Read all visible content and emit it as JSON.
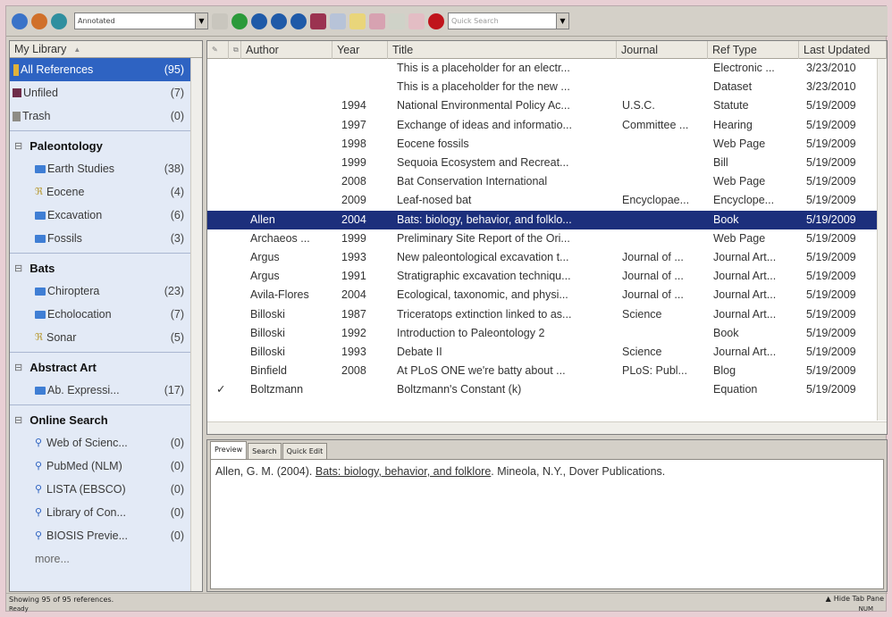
{
  "toolbar": {
    "style_value": "Annotated",
    "quick_search_placeholder": "Quick Search"
  },
  "library": {
    "header": "My Library",
    "all_refs": {
      "label": "All References",
      "count": "(95)"
    },
    "unfiled": {
      "label": "Unfiled",
      "count": "(7)"
    },
    "trash": {
      "label": "Trash",
      "count": "(0)"
    },
    "groups": [
      {
        "title": "Paleontology",
        "items": [
          {
            "label": "Earth Studies",
            "count": "(38)"
          },
          {
            "label": "Eocene",
            "count": "(4)"
          },
          {
            "label": "Excavation",
            "count": "(6)"
          },
          {
            "label": "Fossils",
            "count": "(3)"
          }
        ]
      },
      {
        "title": "Bats",
        "items": [
          {
            "label": "Chiroptera",
            "count": "(23)"
          },
          {
            "label": "Echolocation",
            "count": "(7)"
          },
          {
            "label": "Sonar",
            "count": "(5)"
          }
        ]
      },
      {
        "title": "Abstract Art",
        "items": [
          {
            "label": "Ab. Expressi...",
            "count": "(17)"
          }
        ]
      },
      {
        "title": "Online Search",
        "items": [
          {
            "label": "Web of Scienc...",
            "count": "(0)"
          },
          {
            "label": "PubMed (NLM)",
            "count": "(0)"
          },
          {
            "label": "LISTA (EBSCO)",
            "count": "(0)"
          },
          {
            "label": "Library of Con...",
            "count": "(0)"
          },
          {
            "label": "BIOSIS Previe...",
            "count": "(0)"
          }
        ]
      }
    ],
    "more": "more..."
  },
  "columns": {
    "author": "Author",
    "year": "Year",
    "title": "Title",
    "journal": "Journal",
    "reftype": "Ref Type",
    "updated": "Last Updated"
  },
  "references": [
    {
      "read": "",
      "author": "",
      "year": "",
      "title": "This is a placeholder for an electr...",
      "journal": "",
      "reftype": "Electronic ...",
      "updated": "3/23/2010"
    },
    {
      "read": "",
      "author": "",
      "year": "",
      "title": "This is a placeholder for the new ...",
      "journal": "",
      "reftype": "Dataset",
      "updated": "3/23/2010"
    },
    {
      "read": "",
      "author": "",
      "year": "1994",
      "title": "National Environmental Policy Ac...",
      "journal": "U.S.C.",
      "reftype": "Statute",
      "updated": "5/19/2009"
    },
    {
      "read": "",
      "author": "",
      "year": "1997",
      "title": "Exchange of ideas and informatio...",
      "journal": "Committee ...",
      "reftype": "Hearing",
      "updated": "5/19/2009"
    },
    {
      "read": "",
      "author": "",
      "year": "1998",
      "title": "Eocene fossils",
      "journal": "",
      "reftype": "Web Page",
      "updated": "5/19/2009"
    },
    {
      "read": "",
      "author": "",
      "year": "1999",
      "title": "Sequoia Ecosystem and Recreat...",
      "journal": "",
      "reftype": "Bill",
      "updated": "5/19/2009"
    },
    {
      "read": "",
      "author": "",
      "year": "2008",
      "title": "Bat Conservation International",
      "journal": "",
      "reftype": "Web Page",
      "updated": "5/19/2009"
    },
    {
      "read": "",
      "author": "",
      "year": "2009",
      "title": "Leaf-nosed bat",
      "journal": "Encyclopae...",
      "reftype": "Encyclope...",
      "updated": "5/19/2009"
    },
    {
      "read": "",
      "author": "Allen",
      "year": "2004",
      "title": "Bats: biology, behavior, and folklo...",
      "journal": "",
      "reftype": "Book",
      "updated": "5/19/2009"
    },
    {
      "read": "",
      "author": "Archaeos ...",
      "year": "1999",
      "title": "Preliminary Site Report of the Ori...",
      "journal": "",
      "reftype": "Web Page",
      "updated": "5/19/2009"
    },
    {
      "read": "",
      "author": "Argus",
      "year": "1993",
      "title": "New paleontological excavation t...",
      "journal": "Journal of ...",
      "reftype": "Journal Art...",
      "updated": "5/19/2009"
    },
    {
      "read": "",
      "author": "Argus",
      "year": "1991",
      "title": "Stratigraphic excavation techniqu...",
      "journal": "Journal of ...",
      "reftype": "Journal Art...",
      "updated": "5/19/2009"
    },
    {
      "read": "",
      "author": "Avila-Flores",
      "year": "2004",
      "title": "Ecological, taxonomic, and physi...",
      "journal": "Journal of ...",
      "reftype": "Journal Art...",
      "updated": "5/19/2009"
    },
    {
      "read": "",
      "author": "Billoski",
      "year": "1987",
      "title": "Triceratops extinction linked to as...",
      "journal": "Science",
      "reftype": "Journal Art...",
      "updated": "5/19/2009"
    },
    {
      "read": "",
      "author": "Billoski",
      "year": "1992",
      "title": "Introduction to Paleontology 2",
      "journal": "",
      "reftype": "Book",
      "updated": "5/19/2009"
    },
    {
      "read": "",
      "author": "Billoski",
      "year": "1993",
      "title": "Debate II",
      "journal": "Science",
      "reftype": "Journal Art...",
      "updated": "5/19/2009"
    },
    {
      "read": "",
      "author": "Binfield",
      "year": "2008",
      "title": "At PLoS ONE we're batty about ...",
      "journal": "PLoS: Publ...",
      "reftype": "Blog",
      "updated": "5/19/2009"
    },
    {
      "read": "✓",
      "author": "Boltzmann",
      "year": "",
      "title": "Boltzmann's Constant (k)",
      "journal": "",
      "reftype": "Equation",
      "updated": "5/19/2009"
    }
  ],
  "preview": {
    "tabs": [
      "Preview",
      "Search",
      "Quick Edit"
    ],
    "citation_prefix": "Allen, G. M. (2004). ",
    "citation_title": "Bats: biology, behavior, and folklore",
    "citation_suffix": ". Mineola, N.Y., Dover Publications."
  },
  "status": {
    "showing": "Showing 95 of 95 references.",
    "hide_tab": "Hide Tab Pane",
    "ready": "Ready",
    "num": "NUM"
  }
}
